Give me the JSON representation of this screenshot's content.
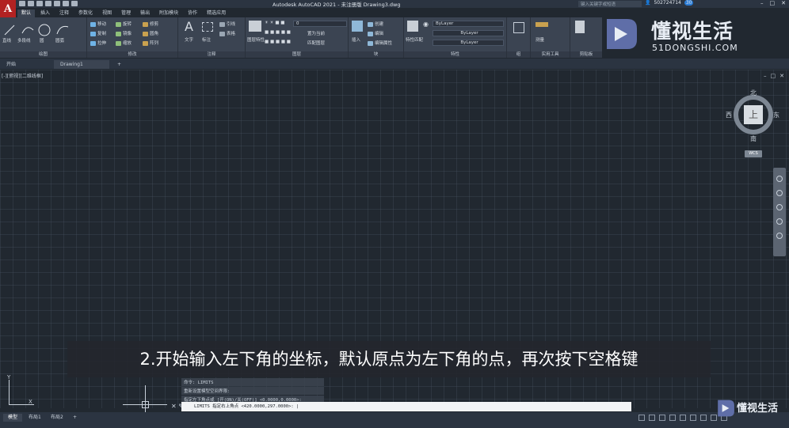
{
  "window": {
    "title": "Autodesk AutoCAD 2021 - 未注册版    Drawing3.dwg",
    "search_placeholder": "键入关键字或短语",
    "user": "502724714",
    "user_badge": "30"
  },
  "ribbon_tabs": [
    "默认",
    "插入",
    "注释",
    "参数化",
    "视图",
    "管理",
    "输出",
    "附加模块",
    "协作",
    "精选应用"
  ],
  "ribbon": {
    "draw_panel": {
      "title": "绘图",
      "line": "直线",
      "polyline": "多段线",
      "circle": "圆",
      "arc": "圆弧"
    },
    "modify_panel": {
      "title": "修改",
      "move": "移动",
      "rotate": "旋转",
      "trim": "修剪",
      "copy": "复制",
      "mirror": "镜像",
      "fillet": "圆角",
      "stretch": "拉伸",
      "scale": "缩放",
      "array": "阵列"
    },
    "annotation_panel": {
      "title": "注释",
      "text": "文字",
      "dimension": "标注",
      "leader": "引线",
      "table": "表格"
    },
    "layers_panel": {
      "title": "图层",
      "layer_props": "图层特性",
      "current_layer": "0",
      "make_current": "置为当前",
      "match_layer": "匹配图层"
    },
    "block_panel": {
      "title": "块",
      "insert": "插入",
      "create": "创建",
      "edit": "编辑",
      "edit_attr": "编辑属性"
    },
    "properties_panel": {
      "title": "特性",
      "match": "特性匹配",
      "color": "ByLayer",
      "linetype": "ByLayer",
      "lineweight": "ByLayer"
    },
    "groups_panel": {
      "title": "组"
    },
    "utilities_panel": {
      "title": "实用工具",
      "measure": "测量"
    },
    "clipboard_panel": {
      "title": "剪贴板"
    }
  },
  "doc_tabs": [
    "开始",
    "Drawing1"
  ],
  "viewport_label": "[-][俯视][二维线框]",
  "viewcube": {
    "north": "北",
    "south": "南",
    "east": "东",
    "west": "西",
    "face": "上",
    "wcs": "WCS"
  },
  "subtitle": "2.开始输入左下角的坐标，默认原点为左下角的点，再次按下空格键",
  "ucs": {
    "x": "X",
    "y": "Y"
  },
  "command_history": [
    "命令: LIMITS",
    "重新设置模型空间界限:",
    "指定左下角点或 [开(ON)/关(OFF)] <0.0000,0.0000>:"
  ],
  "command_line": "LIMITS 指定右上角点 <420.0000,297.0000>: |",
  "layout_tabs": [
    "模型",
    "布局1",
    "布局2"
  ],
  "watermark": {
    "title": "懂视生活",
    "subtitle": "51DONGSHI.COM",
    "small": "懂视生活"
  }
}
